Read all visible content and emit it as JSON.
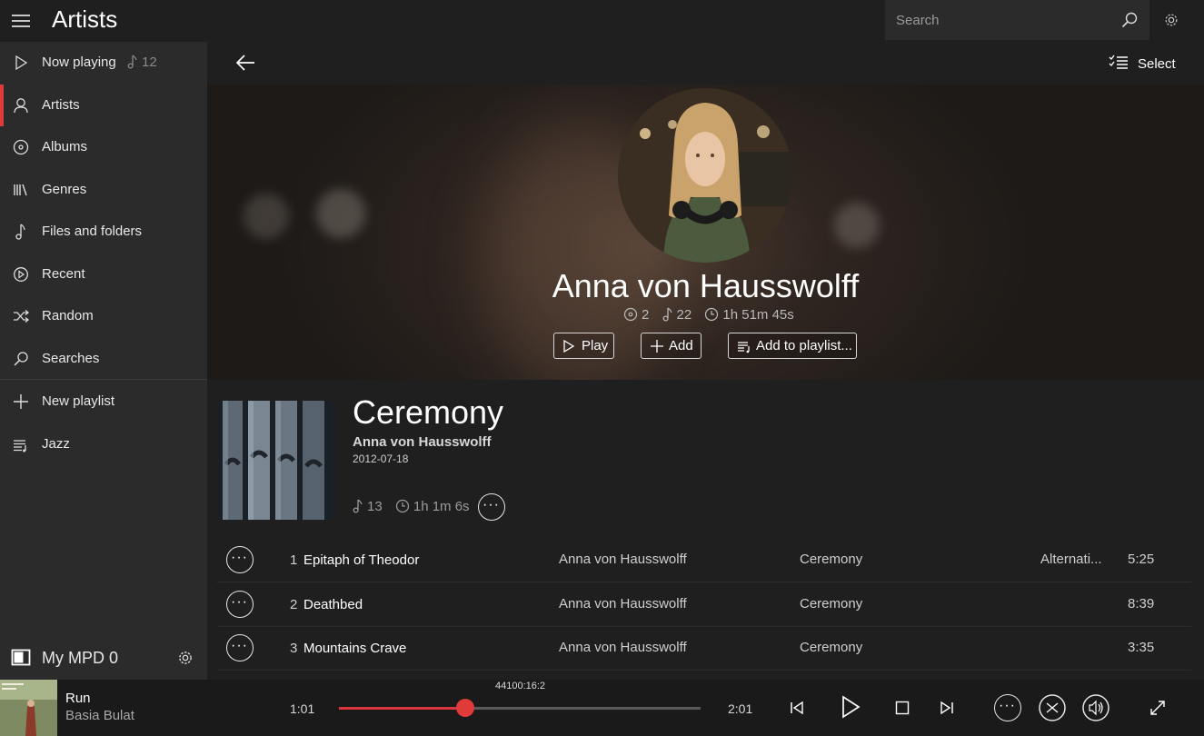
{
  "header": {
    "title": "Artists",
    "search_placeholder": "Search"
  },
  "sidebar": {
    "items": [
      {
        "label": "Now playing",
        "icon": "play-outline-icon",
        "count": "12"
      },
      {
        "label": "Artists",
        "icon": "person-icon",
        "active": true
      },
      {
        "label": "Albums",
        "icon": "disc-icon"
      },
      {
        "label": "Genres",
        "icon": "library-icon"
      },
      {
        "label": "Files and folders",
        "icon": "music-note-icon"
      },
      {
        "label": "Recent",
        "icon": "recent-icon"
      },
      {
        "label": "Random",
        "icon": "shuffle-icon"
      },
      {
        "label": "Searches",
        "icon": "search-icon"
      }
    ],
    "playlists": [
      {
        "label": "New playlist",
        "icon": "plus-icon"
      },
      {
        "label": "Jazz",
        "icon": "playlist-icon"
      }
    ],
    "server": {
      "label": "My MPD 0"
    }
  },
  "main": {
    "select_label": "Select",
    "artist": {
      "name": "Anna von Hausswolff",
      "albums_count": "2",
      "tracks_count": "22",
      "duration": "1h 51m 45s",
      "buttons": {
        "play": "Play",
        "add": "Add",
        "add_to_playlist": "Add to playlist..."
      }
    },
    "album": {
      "title": "Ceremony",
      "artist": "Anna von Hausswolff",
      "date": "2012-07-18",
      "tracks_count": "13",
      "duration": "1h 1m 6s"
    },
    "tracks": [
      {
        "no": "1",
        "name": "Epitaph of Theodor",
        "artist": "Anna von Hausswolff",
        "album": "Ceremony",
        "genre": "Alternati...",
        "duration": "5:25"
      },
      {
        "no": "2",
        "name": "Deathbed",
        "artist": "Anna von Hausswolff",
        "album": "Ceremony",
        "genre": "",
        "duration": "8:39"
      },
      {
        "no": "3",
        "name": "Mountains Crave",
        "artist": "Anna von Hausswolff",
        "album": "Ceremony",
        "genre": "",
        "duration": "3:35"
      }
    ]
  },
  "player": {
    "title": "Run",
    "artist": "Basia Bulat",
    "elapsed": "1:01",
    "total": "2:01",
    "format": "44100:16:2",
    "progress": 0.35
  },
  "colors": {
    "accent": "#e03b3b",
    "background": "#1f1f1f",
    "sidebar": "#2b2b2b"
  }
}
